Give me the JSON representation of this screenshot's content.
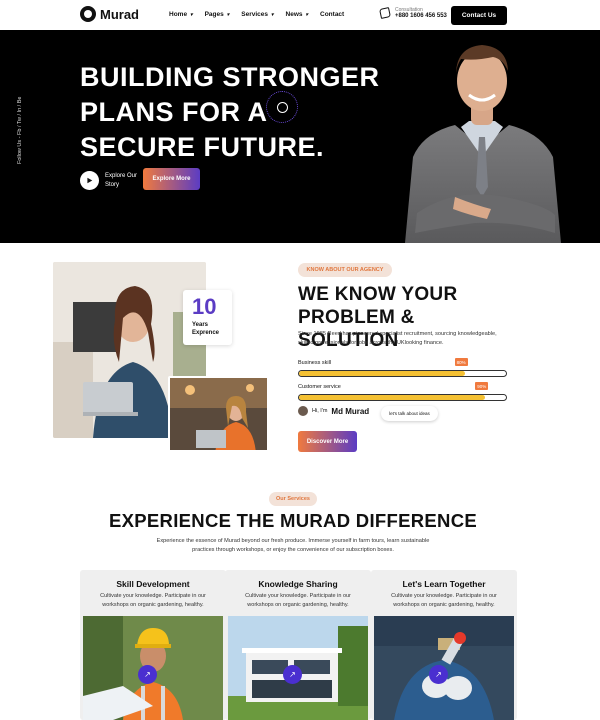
{
  "nav": {
    "logo_text": "Murad",
    "menu": [
      "Home",
      "Pages",
      "Services",
      "News",
      "Contact"
    ],
    "menu_has_caret": [
      true,
      true,
      true,
      true,
      false
    ],
    "consult_label": "Consultation",
    "consult_phone": "+880 1606 456 553",
    "contact_button": "Contact Us"
  },
  "hero": {
    "follow_text": "Follow Us - Fb / Tw / In / Be",
    "title_line1": "BUILDING STRONGER",
    "title_line2": "PLANS FOR A",
    "title_line3": "SECURE FUTURE.",
    "play_label": "Explore Our Story",
    "explore_button": "Explore More"
  },
  "about": {
    "years_number": "10",
    "years_label": "Years Exprence",
    "tag": "KNOW ABOUT OUR AGENCY",
    "title_line1": "WE KNOW YOUR",
    "title_line2": "PROBLEM & SOLUTION",
    "description": "Since 1985 Reed has pioneered specialist recruitment, sourcing knowledgeable, skilled professionals for jobs across the UKlooking finance.",
    "skills": [
      {
        "label": "Business skill",
        "percent_text": "80%",
        "value": 80
      },
      {
        "label": "Customer service",
        "percent_text": "90%",
        "value": 90
      }
    ],
    "hi_text": "Hi, I'm",
    "hi_name": "Md Murad",
    "talk_pill": "let's talk about ideas",
    "discover_button": "Discover More"
  },
  "services": {
    "tag": "Our Services",
    "title": "EXPERIENCE THE MURAD DIFFERENCE",
    "description": "Experience the essence of Murad beyond our fresh produce. Immerse yourself in farm tours, learn sustainable practices through workshops, or enjoy the convenience of our subscription boxes.",
    "cards": [
      {
        "title": "Skill Development",
        "desc": "Cultivate your knowledge. Participate in our workshops on organic gardening, healthy."
      },
      {
        "title": "Knowledge Sharing",
        "desc": "Cultivate your knowledge. Participate in our workshops on organic gardening, healthy."
      },
      {
        "title": "Let's Learn Together",
        "desc": "Cultivate your knowledge. Participate in our workshops on organic gardening, healthy."
      }
    ],
    "arrow_icon": "arrow-up-right-icon"
  },
  "colors": {
    "accent_orange": "#f07a3e",
    "accent_purple": "#5b3cc4",
    "progress_yellow": "#f5c133",
    "hero_bg": "#000000"
  }
}
